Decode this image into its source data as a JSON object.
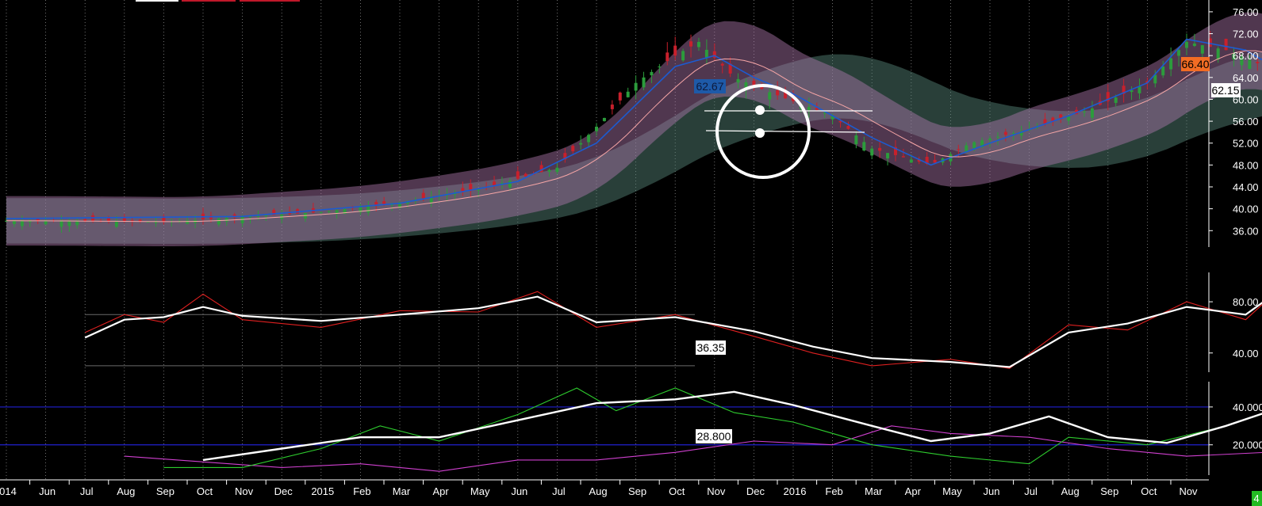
{
  "chart_data": [
    {
      "panel": "price",
      "type": "candlestick",
      "y_ticks": [
        "76.00",
        "72.00",
        "68.00",
        "64.00",
        "60.00",
        "56.00",
        "52.00",
        "48.00",
        "44.00",
        "40.00",
        "36.00"
      ],
      "ylim": [
        33,
        77
      ],
      "price_labels": {
        "last": "62.15",
        "last_color": "#FFFFFF",
        "high_marker": "66.40",
        "high_color": "#F26C24",
        "ma_value": "62.67",
        "ma_color": "#1E5AA8"
      },
      "close_approx": [
        {
          "x": 0,
          "y": 37.8
        },
        {
          "x": 4,
          "y": 37.6
        },
        {
          "x": 6,
          "y": 38.5
        },
        {
          "x": 8,
          "y": 39.4
        },
        {
          "x": 10,
          "y": 41.2
        },
        {
          "x": 12,
          "y": 43.5
        },
        {
          "x": 14,
          "y": 47.5
        },
        {
          "x": 15,
          "y": 55
        },
        {
          "x": 16,
          "y": 63
        },
        {
          "x": 17,
          "y": 68
        },
        {
          "x": 17.6,
          "y": 70.5
        },
        {
          "x": 18.5,
          "y": 64
        },
        {
          "x": 19.5,
          "y": 61
        },
        {
          "x": 21,
          "y": 57
        },
        {
          "x": 22,
          "y": 51
        },
        {
          "x": 23.5,
          "y": 48
        },
        {
          "x": 24.5,
          "y": 52
        },
        {
          "x": 26,
          "y": 54.5
        },
        {
          "x": 27.5,
          "y": 58
        },
        {
          "x": 29,
          "y": 63
        },
        {
          "x": 30,
          "y": 70.5
        },
        {
          "x": 31,
          "y": 69
        },
        {
          "x": 32,
          "y": 66
        },
        {
          "x": 33,
          "y": 62.2
        }
      ],
      "ma_fast_approx": [
        {
          "x": 0,
          "y": 38.2
        },
        {
          "x": 6,
          "y": 38.6
        },
        {
          "x": 10,
          "y": 41
        },
        {
          "x": 13,
          "y": 45
        },
        {
          "x": 15,
          "y": 52
        },
        {
          "x": 16,
          "y": 59
        },
        {
          "x": 17,
          "y": 66
        },
        {
          "x": 18,
          "y": 68
        },
        {
          "x": 19,
          "y": 64
        },
        {
          "x": 20,
          "y": 61
        },
        {
          "x": 22,
          "y": 53
        },
        {
          "x": 23.5,
          "y": 48
        },
        {
          "x": 25,
          "y": 52
        },
        {
          "x": 27,
          "y": 57
        },
        {
          "x": 29,
          "y": 63
        },
        {
          "x": 30,
          "y": 71
        },
        {
          "x": 31.5,
          "y": 69
        },
        {
          "x": 33,
          "y": 62.67
        }
      ]
    },
    {
      "panel": "oscillator-1",
      "type": "line",
      "y_ticks": [
        "80.00",
        "40.00"
      ],
      "ylim": [
        25,
        98
      ],
      "value_label": "36.35",
      "series": [
        {
          "color": "#FFFFFF",
          "values": [
            {
              "x": 2,
              "y": 52
            },
            {
              "x": 3,
              "y": 66
            },
            {
              "x": 4,
              "y": 68
            },
            {
              "x": 5,
              "y": 76
            },
            {
              "x": 6,
              "y": 69
            },
            {
              "x": 8,
              "y": 65
            },
            {
              "x": 10,
              "y": 70
            },
            {
              "x": 12,
              "y": 75
            },
            {
              "x": 13.5,
              "y": 84
            },
            {
              "x": 15,
              "y": 64
            },
            {
              "x": 17,
              "y": 68
            },
            {
              "x": 19,
              "y": 57
            },
            {
              "x": 20.5,
              "y": 45
            },
            {
              "x": 22,
              "y": 36
            },
            {
              "x": 24,
              "y": 33
            },
            {
              "x": 25.5,
              "y": 29
            },
            {
              "x": 27,
              "y": 56
            },
            {
              "x": 28.5,
              "y": 63
            },
            {
              "x": 30,
              "y": 76
            },
            {
              "x": 31.5,
              "y": 70
            },
            {
              "x": 32.5,
              "y": 92
            },
            {
              "x": 34,
              "y": 72
            },
            {
              "x": 35.5,
              "y": 52
            },
            {
              "x": 36.5,
              "y": 36.35
            }
          ]
        },
        {
          "color": "#E02020",
          "values": [
            {
              "x": 2,
              "y": 56
            },
            {
              "x": 3,
              "y": 70
            },
            {
              "x": 4,
              "y": 64
            },
            {
              "x": 5,
              "y": 86
            },
            {
              "x": 6,
              "y": 66
            },
            {
              "x": 8,
              "y": 60
            },
            {
              "x": 10,
              "y": 73
            },
            {
              "x": 12,
              "y": 72
            },
            {
              "x": 13.5,
              "y": 88
            },
            {
              "x": 15,
              "y": 60
            },
            {
              "x": 17,
              "y": 70
            },
            {
              "x": 19,
              "y": 53
            },
            {
              "x": 20.5,
              "y": 40
            },
            {
              "x": 22,
              "y": 30
            },
            {
              "x": 24,
              "y": 35
            },
            {
              "x": 25.5,
              "y": 28
            },
            {
              "x": 27,
              "y": 62
            },
            {
              "x": 28.5,
              "y": 58
            },
            {
              "x": 30,
              "y": 80
            },
            {
              "x": 31.5,
              "y": 66
            },
            {
              "x": 32.5,
              "y": 94
            },
            {
              "x": 34,
              "y": 68
            },
            {
              "x": 35.5,
              "y": 46
            },
            {
              "x": 36.5,
              "y": 34
            }
          ]
        }
      ],
      "reference_lines": [
        70,
        30
      ]
    },
    {
      "panel": "oscillator-2",
      "type": "line",
      "y_ticks": [
        "40.000",
        "20.000"
      ],
      "ylim": [
        4,
        50
      ],
      "value_label": "28.800",
      "reference_lines": [
        40,
        20
      ],
      "series": [
        {
          "color": "#FFFFFF",
          "values": [
            {
              "x": 5,
              "y": 12
            },
            {
              "x": 7,
              "y": 18
            },
            {
              "x": 9,
              "y": 24
            },
            {
              "x": 11,
              "y": 24
            },
            {
              "x": 13,
              "y": 33
            },
            {
              "x": 15,
              "y": 42
            },
            {
              "x": 17,
              "y": 44
            },
            {
              "x": 18.5,
              "y": 48
            },
            {
              "x": 20,
              "y": 41
            },
            {
              "x": 22,
              "y": 30
            },
            {
              "x": 23.5,
              "y": 22
            },
            {
              "x": 25,
              "y": 26
            },
            {
              "x": 26.5,
              "y": 35
            },
            {
              "x": 28,
              "y": 24
            },
            {
              "x": 29.5,
              "y": 21
            },
            {
              "x": 31,
              "y": 30
            },
            {
              "x": 32.5,
              "y": 40.5
            },
            {
              "x": 34,
              "y": 40
            },
            {
              "x": 35.5,
              "y": 34
            },
            {
              "x": 36.5,
              "y": 28.8
            }
          ]
        },
        {
          "color": "#2ECC2E",
          "values": [
            {
              "x": 4,
              "y": 8
            },
            {
              "x": 6,
              "y": 8
            },
            {
              "x": 8,
              "y": 18
            },
            {
              "x": 9.5,
              "y": 30
            },
            {
              "x": 11,
              "y": 22
            },
            {
              "x": 13,
              "y": 36
            },
            {
              "x": 14.5,
              "y": 50
            },
            {
              "x": 15.5,
              "y": 38
            },
            {
              "x": 17,
              "y": 50
            },
            {
              "x": 18.5,
              "y": 37
            },
            {
              "x": 20,
              "y": 32
            },
            {
              "x": 22,
              "y": 20
            },
            {
              "x": 24,
              "y": 14
            },
            {
              "x": 26,
              "y": 10
            },
            {
              "x": 27,
              "y": 24
            },
            {
              "x": 29,
              "y": 20
            },
            {
              "x": 31,
              "y": 30
            },
            {
              "x": 32.5,
              "y": 40
            },
            {
              "x": 34,
              "y": 30
            },
            {
              "x": 35.5,
              "y": 28
            },
            {
              "x": 36.5,
              "y": 22
            }
          ]
        },
        {
          "color": "#D040D0",
          "values": [
            {
              "x": 3,
              "y": 14
            },
            {
              "x": 5,
              "y": 11
            },
            {
              "x": 7,
              "y": 8
            },
            {
              "x": 9,
              "y": 10
            },
            {
              "x": 11,
              "y": 6
            },
            {
              "x": 13,
              "y": 12
            },
            {
              "x": 15,
              "y": 12
            },
            {
              "x": 17,
              "y": 16
            },
            {
              "x": 19,
              "y": 22
            },
            {
              "x": 21,
              "y": 20
            },
            {
              "x": 22.5,
              "y": 30
            },
            {
              "x": 24,
              "y": 26
            },
            {
              "x": 26,
              "y": 24
            },
            {
              "x": 28,
              "y": 18
            },
            {
              "x": 30,
              "y": 14
            },
            {
              "x": 32,
              "y": 16
            },
            {
              "x": 34,
              "y": 18
            },
            {
              "x": 35.5,
              "y": 20
            },
            {
              "x": 36.5,
              "y": 24
            }
          ]
        }
      ]
    }
  ],
  "x_axis": {
    "labels": [
      "014",
      "Jun",
      "Jul",
      "Aug",
      "Sep",
      "Oct",
      "Nov",
      "Dec",
      "2015",
      "Feb",
      "Mar",
      "Apr",
      "May",
      "Jun",
      "Jul",
      "Aug",
      "Sep",
      "Oct",
      "Nov",
      "Dec",
      "2016",
      "Feb",
      "Mar",
      "Apr",
      "May",
      "Jun",
      "Jul",
      "Aug",
      "Sep",
      "Oct",
      "Nov"
    ],
    "corner_badge": "4",
    "corner_badge_color": "#22BB22"
  },
  "annotation": {
    "type": "circle-with-two-horizontal-lines",
    "color": "#FFFFFF"
  }
}
